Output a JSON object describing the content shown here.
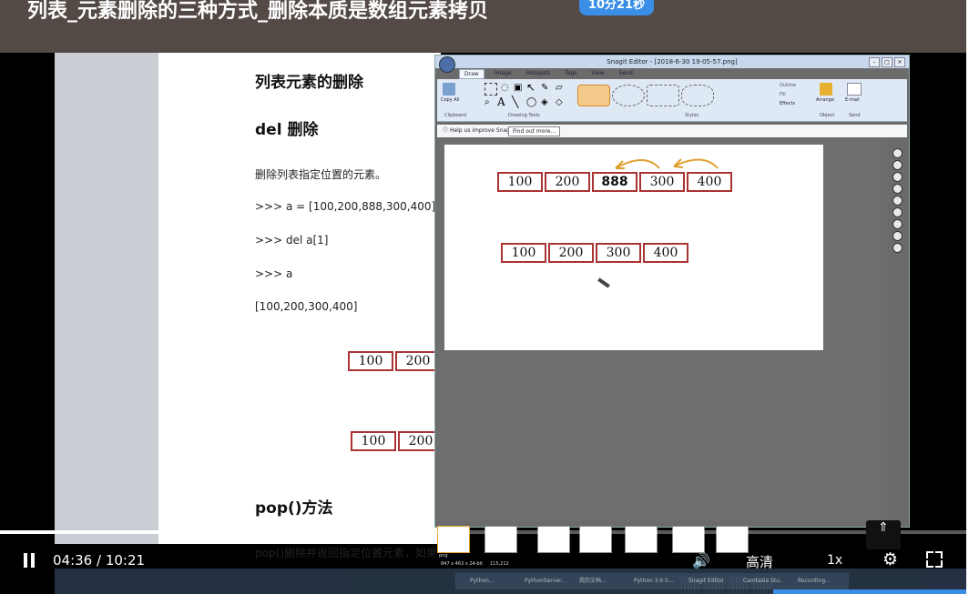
{
  "header": {
    "title": "列表_元素删除的三种方式_删除本质是数组元素拷贝",
    "duration_badge": "10分21秒"
  },
  "document": {
    "heading": "列表元素的删除",
    "subheading": "del  删除",
    "lines": [
      "删除列表指定位置的元素。",
      ">>> a = [100,200,888,300,400]",
      ">>> del a[1]",
      ">>> a",
      "[100,200,300,400]"
    ],
    "array1": [
      "100",
      "200"
    ],
    "array2": [
      "100",
      "200"
    ],
    "pop_heading": "pop()方法",
    "pop_line": "pop()删除并返回指定位置元素，如果"
  },
  "snagit": {
    "window_title": "Snagit Editor - [2018-6-30 19-05-57.png]",
    "tabs": [
      "Draw",
      "Image",
      "Hotspots",
      "Tags",
      "View",
      "Send"
    ],
    "group_labels": [
      "Clipboard",
      "Drawing Tools",
      "Styles",
      "Object",
      "Send"
    ],
    "button_copy_all": "Copy All",
    "button_arrange": "Arrange",
    "button_email": "E-mail",
    "menu_outline": "Outline",
    "menu_fill": "Fill",
    "menu_effects": "Effects",
    "help_text": "Help us improve Snagit",
    "find_out_more": "Find out more...",
    "canvas_row1": [
      "100",
      "200",
      "888",
      "300",
      "400"
    ],
    "canvas_row2": [
      "100",
      "200",
      "300",
      "400"
    ],
    "status_size": "847 x 463 x 24-bit",
    "status_pos": "115,212",
    "thumb_label": "png"
  },
  "player": {
    "current_time": "04:36",
    "total_time": "10:21",
    "time_display": "04:36 / 10:21",
    "quality": "高清",
    "speed": "1x",
    "progress": 0.444
  },
  "taskbar": {
    "items": [
      "Python...",
      "PythonServer...",
      "我的文档...",
      "Python 3.6.5...",
      "Snagit Editor",
      "Camtasia Stu...",
      "Recording..."
    ]
  }
}
